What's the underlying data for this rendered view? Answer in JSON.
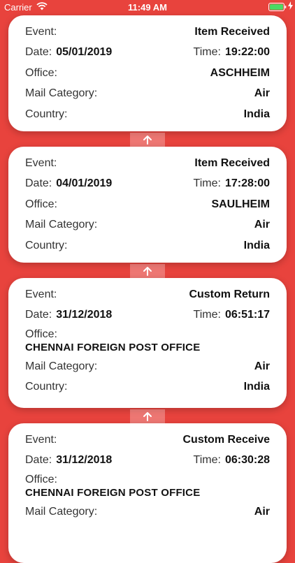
{
  "status_bar": {
    "carrier": "Carrier",
    "time": "11:49 AM"
  },
  "labels": {
    "event": "Event:",
    "date": "Date:",
    "time": "Time:",
    "office": "Office:",
    "mail_category": "Mail Category:",
    "country": "Country:"
  },
  "events": [
    {
      "event": "Item Received",
      "date": "05/01/2019",
      "time": "19:22:00",
      "office": "ASCHHEIM",
      "mail_category": "Air",
      "country": "India"
    },
    {
      "event": "Item Received",
      "date": "04/01/2019",
      "time": "17:28:00",
      "office": "SAULHEIM",
      "mail_category": "Air",
      "country": "India"
    },
    {
      "event": "Custom Return",
      "date": "31/12/2018",
      "time": "06:51:17",
      "office": "CHENNAI FOREIGN POST OFFICE",
      "mail_category": "Air",
      "country": "India"
    },
    {
      "event": "Custom Receive",
      "date": "31/12/2018",
      "time": "06:30:28",
      "office": "CHENNAI FOREIGN POST OFFICE",
      "mail_category": "Air"
    }
  ],
  "colors": {
    "background": "#e8433d",
    "card": "#ffffff",
    "battery": "#4cd964"
  },
  "icons": {
    "connector": "arrow-up-icon",
    "wifi": "wifi-icon",
    "battery": "battery-icon",
    "charging": "charging-bolt-icon"
  }
}
